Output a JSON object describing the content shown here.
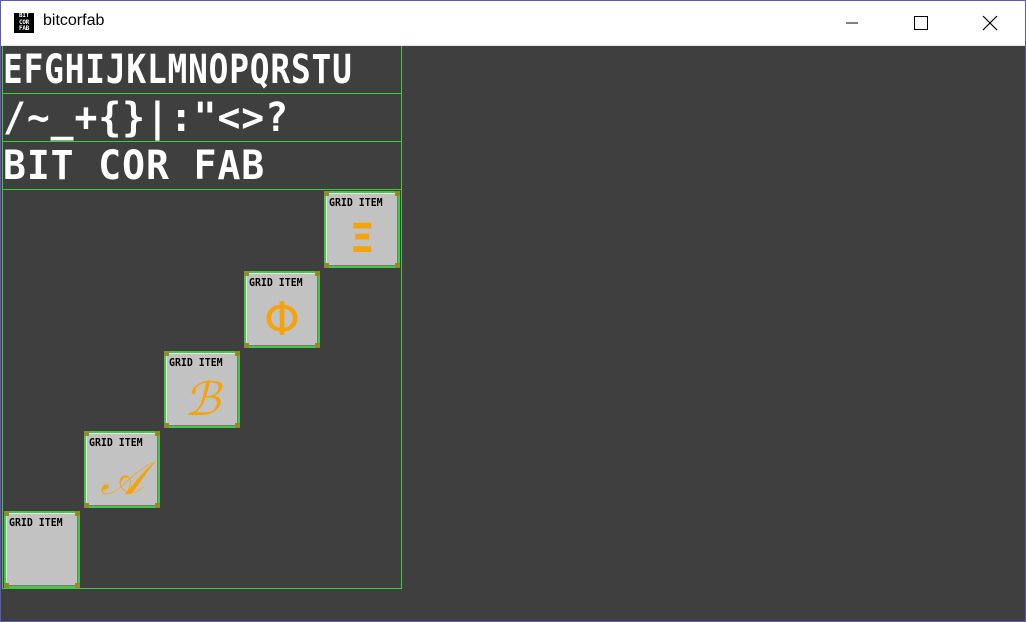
{
  "window": {
    "title": "bitcorfab",
    "app_icon_lines": [
      "BIT",
      "COR",
      "FAB"
    ]
  },
  "text_rows": [
    "EFGHIJKLMNOPQRSTU",
    "/~_+{}|:\"<>?",
    "BIT COR FAB"
  ],
  "grid_items": [
    {
      "label": "GRID ITEM",
      "glyph": "Ξ"
    },
    {
      "label": "GRID ITEM",
      "glyph": "Φ"
    },
    {
      "label": "GRID ITEM",
      "glyph": "ℬ"
    },
    {
      "label": "GRID ITEM",
      "glyph": "𝒜"
    },
    {
      "label": "GRID ITEM",
      "glyph": ""
    }
  ],
  "colors": {
    "background": "#3f3f3f",
    "grid_line": "#41c941",
    "glyph": "#f5a30a",
    "item_fill": "#c2c2c2"
  },
  "icons": {
    "minimize": "minimize-icon",
    "maximize": "maximize-icon",
    "close": "close-icon"
  }
}
